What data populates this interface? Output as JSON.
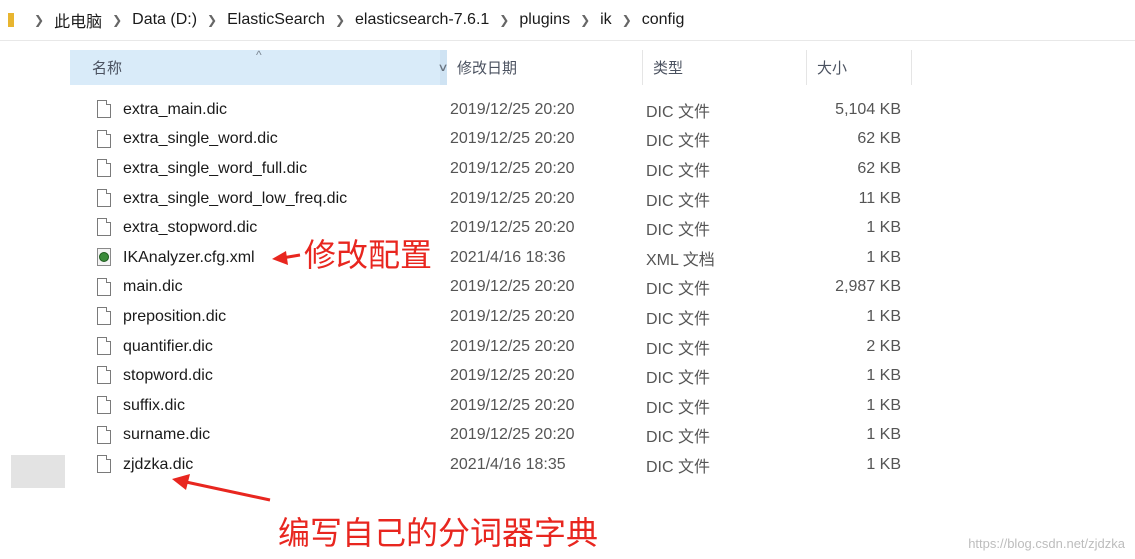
{
  "breadcrumb": {
    "items": [
      {
        "label": "此电脑"
      },
      {
        "label": "Data (D:)"
      },
      {
        "label": "ElasticSearch"
      },
      {
        "label": "elasticsearch-7.6.1"
      },
      {
        "label": "plugins"
      },
      {
        "label": "ik"
      },
      {
        "label": "config"
      }
    ]
  },
  "columns": {
    "name": "名称",
    "date": "修改日期",
    "type": "类型",
    "size": "大小"
  },
  "files": [
    {
      "name": "extra_main.dic",
      "date": "2019/12/25 20:20",
      "type": "DIC 文件",
      "size": "5,104 KB",
      "icon": "file-icon"
    },
    {
      "name": "extra_single_word.dic",
      "date": "2019/12/25 20:20",
      "type": "DIC 文件",
      "size": "62 KB",
      "icon": "file-icon"
    },
    {
      "name": "extra_single_word_full.dic",
      "date": "2019/12/25 20:20",
      "type": "DIC 文件",
      "size": "62 KB",
      "icon": "file-icon"
    },
    {
      "name": "extra_single_word_low_freq.dic",
      "date": "2019/12/25 20:20",
      "type": "DIC 文件",
      "size": "11 KB",
      "icon": "file-icon"
    },
    {
      "name": "extra_stopword.dic",
      "date": "2019/12/25 20:20",
      "type": "DIC 文件",
      "size": "1 KB",
      "icon": "file-icon"
    },
    {
      "name": "IKAnalyzer.cfg.xml",
      "date": "2021/4/16 18:36",
      "type": "XML 文档",
      "size": "1 KB",
      "icon": "xml-file-icon"
    },
    {
      "name": "main.dic",
      "date": "2019/12/25 20:20",
      "type": "DIC 文件",
      "size": "2,987 KB",
      "icon": "file-icon"
    },
    {
      "name": "preposition.dic",
      "date": "2019/12/25 20:20",
      "type": "DIC 文件",
      "size": "1 KB",
      "icon": "file-icon"
    },
    {
      "name": "quantifier.dic",
      "date": "2019/12/25 20:20",
      "type": "DIC 文件",
      "size": "2 KB",
      "icon": "file-icon"
    },
    {
      "name": "stopword.dic",
      "date": "2019/12/25 20:20",
      "type": "DIC 文件",
      "size": "1 KB",
      "icon": "file-icon"
    },
    {
      "name": "suffix.dic",
      "date": "2019/12/25 20:20",
      "type": "DIC 文件",
      "size": "1 KB",
      "icon": "file-icon"
    },
    {
      "name": "surname.dic",
      "date": "2019/12/25 20:20",
      "type": "DIC 文件",
      "size": "1 KB",
      "icon": "file-icon"
    },
    {
      "name": "zjdzka.dic",
      "date": "2021/4/16 18:35",
      "type": "DIC 文件",
      "size": "1 KB",
      "icon": "file-icon"
    }
  ],
  "annotations": {
    "modify_config": "修改配置",
    "write_dictionary": "编写自己的分词器字典",
    "color": "#e8261f"
  },
  "watermark": "https://blog.csdn.net/zjdzka"
}
